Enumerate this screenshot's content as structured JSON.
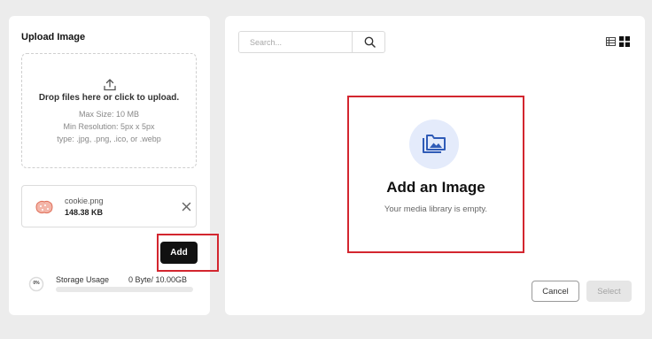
{
  "upload": {
    "title": "Upload Image",
    "dropzone": {
      "icon": "upload-icon",
      "text": "Drop files here or click to upload.",
      "max_size": "Max Size: 10 MB",
      "min_resolution": "Min Resolution: 5px x 5px",
      "types": "type: .jpg, .png, .ico, or .webp"
    },
    "file": {
      "name": "cookie.png",
      "size": "148.38 KB",
      "thumb_icon": "cookie-image-thumbnail",
      "remove_icon": "close-icon"
    },
    "add_label": "Add"
  },
  "storage": {
    "percent_label": "0%",
    "label": "Storage Usage",
    "value": "0 Byte/ 10.00GB",
    "fraction_used": 0
  },
  "library": {
    "search_placeholder": "Search...",
    "search_icon": "search-icon",
    "view_icons": [
      "list-view-icon",
      "grid-view-icon"
    ],
    "empty_title": "Add an Image",
    "empty_subtitle": "Your media library is empty.",
    "empty_icon": "image-folder-icon",
    "cancel_label": "Cancel",
    "select_label": "Select"
  },
  "colors": {
    "highlight": "#d3262f",
    "accent": "#2f5bb7",
    "icon_bg": "#e4ebfb",
    "primary_button": "#111111"
  }
}
